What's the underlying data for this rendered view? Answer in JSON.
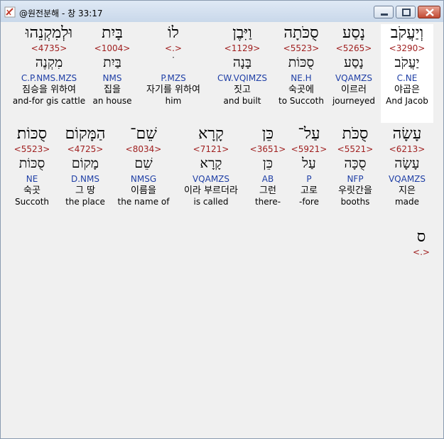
{
  "window": {
    "title": "@원전분해 - 창 33:17",
    "icon": "app-icon"
  },
  "controls": {
    "minimize": "minimize-icon",
    "maximize": "maximize-icon",
    "close": "close-icon"
  },
  "row1": [
    {
      "heb": "וְיַעֲקֹב",
      "strong": "<3290>",
      "lemma": "יַעֲקֹב",
      "parse": "C.NE",
      "kor": "야곱은",
      "eng": "And Jacob"
    },
    {
      "heb": "נָסַע",
      "strong": "<5265>",
      "lemma": "נָסַע",
      "parse": "VQAMZS",
      "kor": "이르러",
      "eng": "journeyed"
    },
    {
      "heb": "סֻכֹּתָה",
      "strong": "<5523>",
      "lemma": "סֻכּוֹת",
      "parse": "NE.H",
      "kor": "숙곳에",
      "eng": "to Succoth"
    },
    {
      "heb": "וַיִּבֶן",
      "strong": "<1129>",
      "lemma": "בָּנָה",
      "parse": "CW.VQIMZS",
      "kor": "짓고",
      "eng": "and built"
    },
    {
      "heb": "לוֹ",
      "strong": "<.>",
      "lemma": "ׁ",
      "parse": "P.MZS",
      "kor": "자기를 위하여",
      "eng": "him"
    },
    {
      "heb": "בָּיִת",
      "strong": "<1004>",
      "lemma": "בַּיִת",
      "parse": "NMS",
      "kor": "집을",
      "eng": "an house"
    },
    {
      "heb": "וּלְמִקְנֵהוּ",
      "strong": "<4735>",
      "lemma": "מִקְנֶה",
      "parse": "C.P.NMS.MZS",
      "kor": "짐승을 위하여",
      "eng": "and-for gis cattle"
    }
  ],
  "row2": [
    {
      "heb": "עָשָׂה",
      "strong": "<6213>",
      "lemma": "עָשָׂה",
      "parse": "VQAMZS",
      "kor": "지은",
      "eng": "made"
    },
    {
      "heb": "סֻכֹּת",
      "strong": "<5521>",
      "lemma": "סֻכָּה",
      "parse": "NFP",
      "kor": "우릿간을",
      "eng": "booths"
    },
    {
      "heb": "עַל־",
      "strong": "<5921>",
      "lemma": "עַל",
      "parse": "P",
      "kor": "고로",
      "eng": "-fore"
    },
    {
      "heb": "כֵּן",
      "strong": "<3651>",
      "lemma": "כֵּן",
      "parse": "AB",
      "kor": "그런",
      "eng": "there-"
    },
    {
      "heb": "קָרָא",
      "strong": "<7121>",
      "lemma": "קָרָא",
      "parse": "VQAMZS",
      "kor": "이라 부르더라",
      "eng": "is called"
    },
    {
      "heb": "שֵׁם־",
      "strong": "<8034>",
      "lemma": "שֵׁם",
      "parse": "NMSG",
      "kor": "이름을",
      "eng": "the name of"
    },
    {
      "heb": "הַמָּקוֹם",
      "strong": "<4725>",
      "lemma": "מָקוֹם",
      "parse": "D.NMS",
      "kor": "그 땅",
      "eng": "the place"
    },
    {
      "heb": "סֻכּוֹת׃",
      "strong": "<5523>",
      "lemma": "סֻכּוֹת",
      "parse": "NE",
      "kor": "숙곳",
      "eng": "Succoth"
    }
  ],
  "row3": [
    {
      "heb": "ס",
      "strong": "<.>"
    }
  ]
}
